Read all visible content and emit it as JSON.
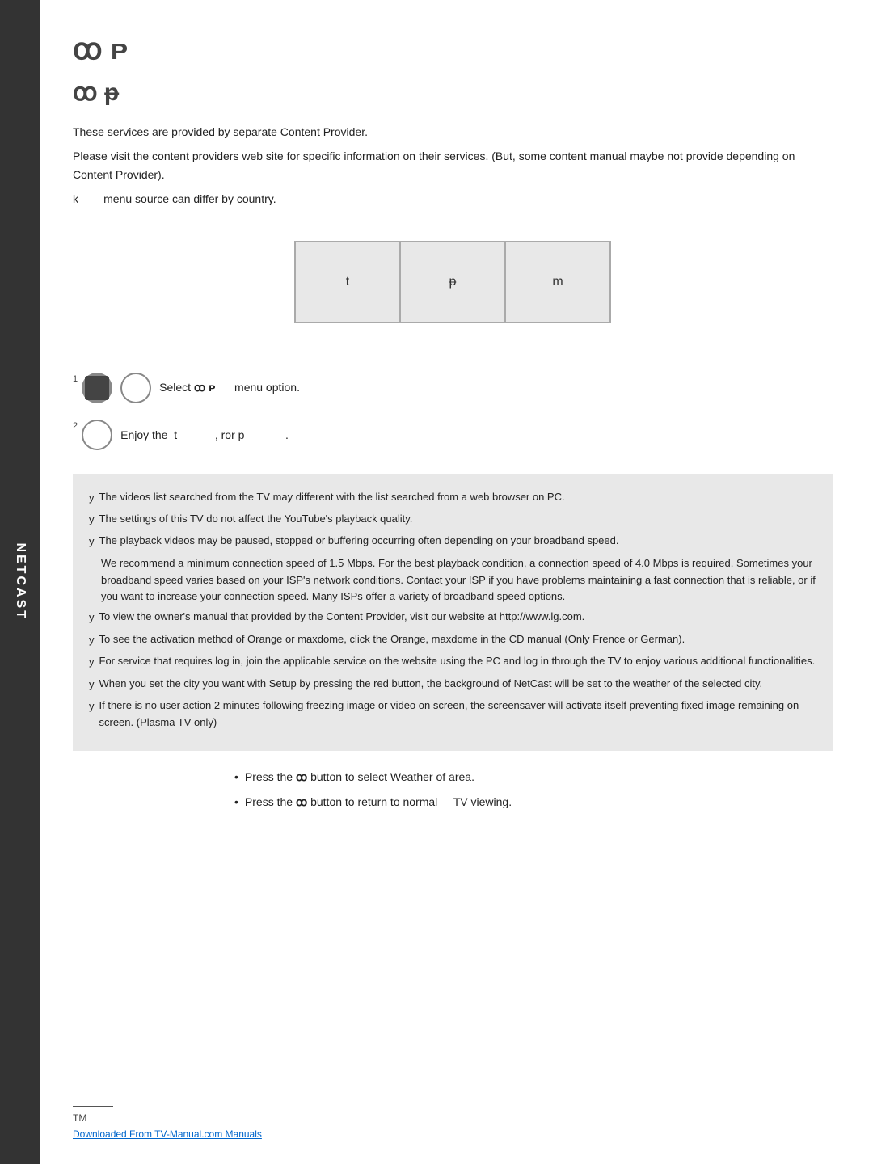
{
  "sidebar": {
    "label": "NETCAST"
  },
  "header": {
    "symbol_large": "ꝏ ᴘ",
    "symbol_medium": "ꝏ ᵽ",
    "description_lines": [
      "These services are provided by separate Content Provider.",
      "Please visit the content providers web site for specific information on their services. (But, some content manual maybe not provide depending on Content Provider).",
      "k          menu source can differ by country."
    ]
  },
  "menu_boxes": {
    "box1_label": "t",
    "box2_label": "ᵽ",
    "box3_label": "m"
  },
  "steps": {
    "step1": {
      "number": "1",
      "text": "Select ꝏ ᴘ          menu option."
    },
    "step2": {
      "number": "2",
      "text": "Enjoy the  t            , ror ᵽ              ."
    }
  },
  "notes": [
    "The videos list searched from the TV may different with the list searched from a web browser on PC.",
    "The settings of this TV do not affect the YouTube's playback quality.",
    "The playback videos may be paused, stopped or buffering occurring often depending on your broadband speed.",
    "We recommend a minimum connection speed of 1.5 Mbps. For the best playback condition, a connection speed of 4.0 Mbps is required. Sometimes your broadband speed varies based on your ISP's network conditions. Contact your ISP if you have problems maintaining a fast connection that is reliable, or if you want to increase your connection speed. Many ISPs offer a variety of broadband speed options.",
    "To view the owner's manual that provided by the Content Provider, visit our website at http://www.lg.com.",
    "To see the activation method of Orange or maxdome, click the Orange, maxdome in the CD manual (Only Frence or German).",
    "For service that requires log in, join the applicable service on the website using the PC and log in through the TV to enjoy various additional functionalities.",
    "When you set the city you want with Setup by pressing the red button, the background of NetCast will be set to the weather of the selected city.",
    "If there is no user action 2 minutes following freezing image or video on screen, the screensaver will activate itself preventing fixed image remaining on screen. (Plasma TV only)"
  ],
  "bottom_bullets": [
    "Press the ꝏ button to select Weather of area.",
    "Press the ꝏ button to return to normal      TV viewing."
  ],
  "footer": {
    "tm_label": "TM",
    "link_text": "Downloaded From TV-Manual.com Manuals",
    "link_url": "#"
  }
}
